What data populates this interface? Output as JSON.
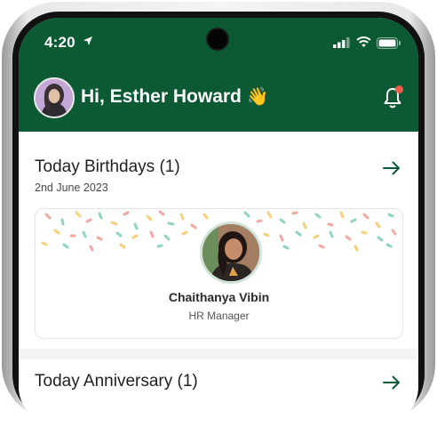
{
  "status_bar": {
    "time": "4:20"
  },
  "header": {
    "greeting": "Hi, Esther Howard",
    "wave": "👋",
    "has_notification": true
  },
  "birthdays": {
    "title": "Today Birthdays (1)",
    "date": "2nd June 2023",
    "people": [
      {
        "name": "Chaithanya Vibin",
        "role": "HR Manager"
      }
    ]
  },
  "anniversary": {
    "title": "Today Anniversary (1)"
  },
  "colors": {
    "header_bg": "#0c5a33",
    "accent_green": "#0c5a33",
    "notification_dot": "#f05a4a"
  }
}
